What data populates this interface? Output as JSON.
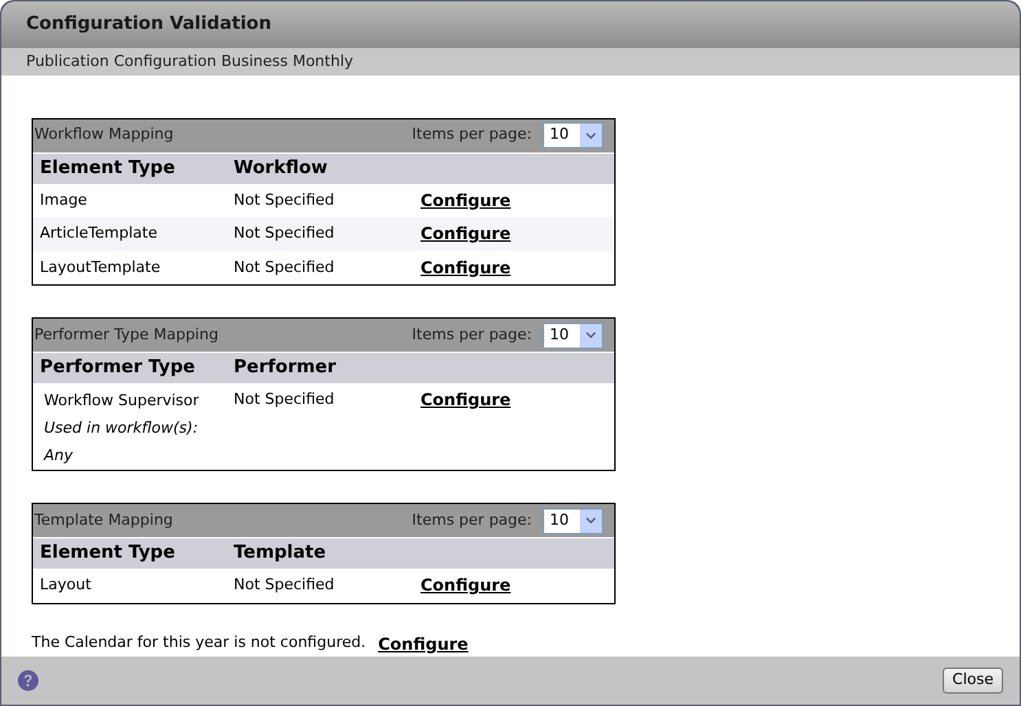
{
  "window": {
    "title": "Configuration Validation",
    "subtitle": "Publication Configuration Business Monthly"
  },
  "tables": [
    {
      "title": "Workflow Mapping",
      "items_per_page_label": "Items per page:",
      "items_per_page": "10",
      "columns": [
        "Element Type",
        "Workflow"
      ],
      "rows": [
        {
          "name": "Image",
          "value": "Not Specified",
          "action": "Configure"
        },
        {
          "name": "ArticleTemplate",
          "value": "Not Specified",
          "action": "Configure"
        },
        {
          "name": "LayoutTemplate",
          "value": "Not Specified",
          "action": "Configure"
        }
      ]
    },
    {
      "title": "Performer Type Mapping",
      "items_per_page_label": "Items per page:",
      "items_per_page": "10",
      "columns": [
        "Performer Type",
        "Performer"
      ],
      "rows": [
        {
          "name": "Workflow Supervisor",
          "notes": [
            "Used in workflow(s):",
            "Any"
          ],
          "value": "Not Specified",
          "action": "Configure"
        }
      ]
    },
    {
      "title": "Template Mapping",
      "items_per_page_label": "Items per page:",
      "items_per_page": "10",
      "columns": [
        "Element Type",
        "Template"
      ],
      "rows": [
        {
          "name": "Layout",
          "value": "Not Specified",
          "action": "Configure"
        }
      ]
    }
  ],
  "calendar": {
    "message": "The Calendar for this year is not configured.",
    "action": "Configure"
  },
  "footer": {
    "close_button": "Close"
  }
}
